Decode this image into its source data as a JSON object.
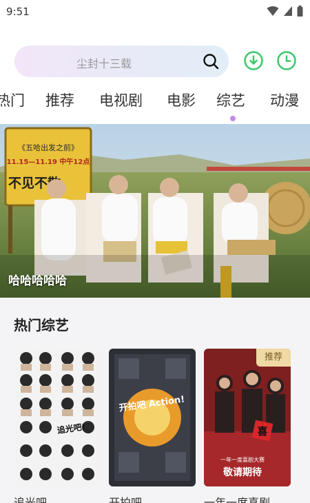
{
  "status_bar": {
    "time": "9:51"
  },
  "search": {
    "placeholder_text": "尘封十三载"
  },
  "tabs": [
    {
      "label": "热门"
    },
    {
      "label": "推荐"
    },
    {
      "label": "电视剧"
    },
    {
      "label": "电影"
    },
    {
      "label": "综艺",
      "active": true
    },
    {
      "label": "动漫"
    }
  ],
  "banner": {
    "title": "哈哈哈哈哈",
    "sign_title": "《五哈出发之前》",
    "sign_date": "11.15—11.19 中午12点",
    "sign_tagline": "不见不散"
  },
  "section": {
    "title": "热门综艺",
    "cards": [
      {
        "title": "追光吧",
        "poster_text": "追光吧!"
      },
      {
        "title": "开拍吧",
        "poster_text": "开拍吧 Action!"
      },
      {
        "title": "一年一度喜剧",
        "badge": "推荐",
        "poster_text": "敬请期待",
        "poster_top_text": "一年一度喜剧大赛",
        "poster_sign": "喜"
      }
    ]
  },
  "colors": {
    "accent": "#c38ce8",
    "green": "#3cc76a",
    "badge_bg": "#efd9a4"
  }
}
